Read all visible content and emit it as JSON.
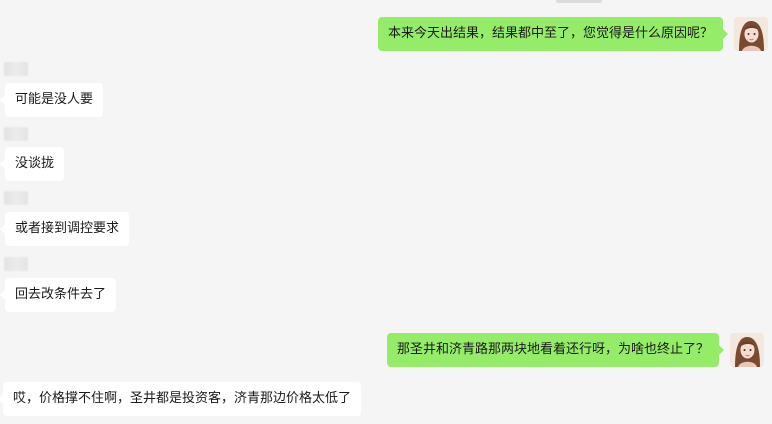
{
  "messages": [
    {
      "side": "sent",
      "text": "本来今天出结果，结果都中至了，您觉得是什么原因呢？"
    },
    {
      "side": "received",
      "text": "可能是没人要"
    },
    {
      "side": "received",
      "text": "没谈拢"
    },
    {
      "side": "received",
      "text": "或者接到调控要求"
    },
    {
      "side": "received",
      "text": "回去改条件去了"
    },
    {
      "side": "sent",
      "text": "那圣井和济青路那两块地看着还行呀，为啥也终止了？"
    },
    {
      "side": "received",
      "text": "哎，价格撑不住啊，圣井都是投资客，济青那边价格太低了"
    }
  ],
  "colors": {
    "background": "#f5f5f5",
    "sent_bubble": "#95ec69",
    "received_bubble": "#ffffff",
    "text": "#1a1a1a"
  },
  "icons": {
    "self_avatar": "avatar-icon"
  }
}
